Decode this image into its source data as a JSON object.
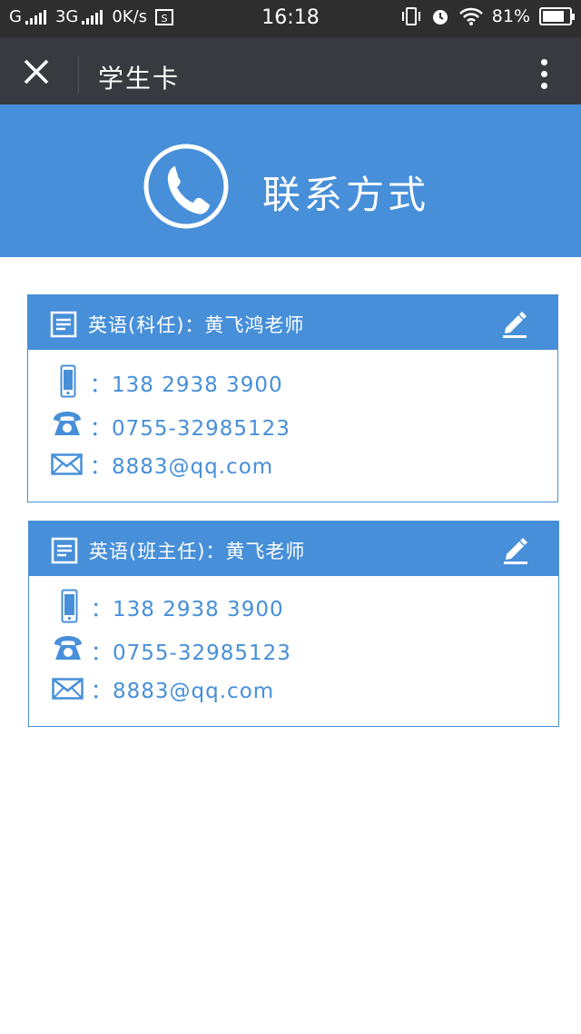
{
  "status_bar": {
    "carrier1": "G",
    "carrier2": "3G",
    "speed": "0K/s",
    "time": "16:18",
    "battery": "81%",
    "battery_level": 0.81
  },
  "nav": {
    "title": "学生卡"
  },
  "banner": {
    "title": "联系方式",
    "color": "#478fd9"
  },
  "cards": [
    {
      "header": "英语(科任)：黄飞鸿老师",
      "phone": "：138 2938 3900",
      "landline": "：0755-32985123",
      "email": "：8883@qq.com"
    },
    {
      "header": "英语(班主任)：黄飞老师",
      "phone": "：138 2938 3900",
      "landline": "：0755-32985123",
      "email": "：8883@qq.com"
    }
  ],
  "colors": {
    "accent": "#478fd9",
    "navbar": "#393a3f",
    "statusbar": "#2e2e2e"
  },
  "icons": [
    "close-icon",
    "more-icon",
    "phone-handset-icon",
    "document-icon",
    "edit-icon",
    "mobile-phone-icon",
    "telephone-icon",
    "mail-icon"
  ]
}
